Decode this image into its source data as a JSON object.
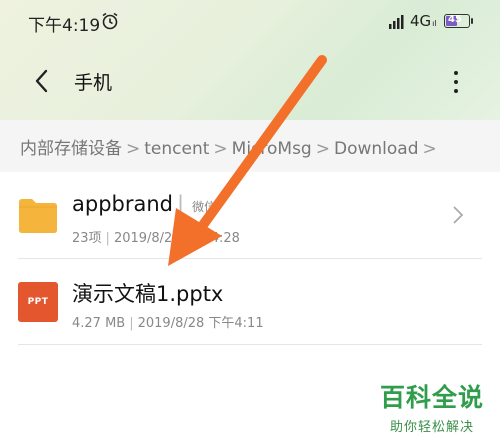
{
  "status_bar": {
    "time": "下午4:19",
    "network": "4G",
    "battery_level": "45",
    "battery_fraction": 0.45
  },
  "header": {
    "title": "手机",
    "back_icon": "chevron-left-icon",
    "more_icon": "more-vertical-icon"
  },
  "breadcrumb": {
    "items": [
      "内部存储设备",
      "tencent",
      "MicroMsg",
      "Download"
    ]
  },
  "files": [
    {
      "name": "appbrand",
      "tag": "微信",
      "items": "23项",
      "date": "2019/8/23 下午4:28",
      "icon": "folder-icon",
      "color": "#f5b43c"
    },
    {
      "name": "演示文稿1.pptx",
      "size": "4.27 MB",
      "date": "2019/8/28 下午4:11",
      "icon": "ppt-file-icon",
      "icon_label": "PPT",
      "color": "#e4572e"
    }
  ],
  "annotation": {
    "arrow_color": "#f2702a"
  },
  "watermark": {
    "main": "百科全说",
    "sub": "助你轻松解决"
  }
}
